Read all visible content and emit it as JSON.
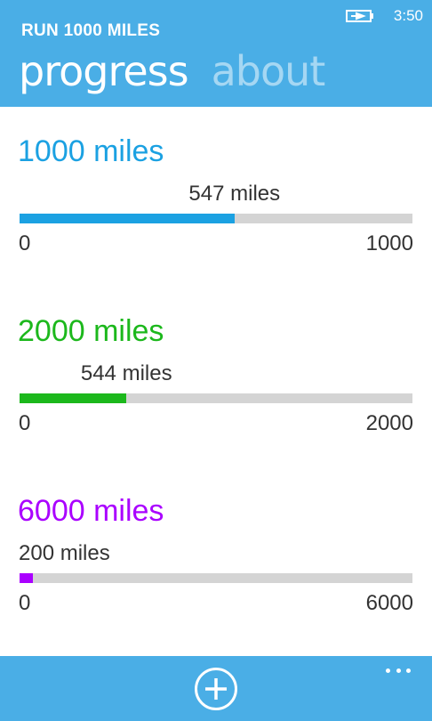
{
  "status": {
    "time": "3:50",
    "battery_icon": "battery-charging-icon"
  },
  "app": {
    "title": "RUN 1000 MILES"
  },
  "pivot": {
    "active": "progress",
    "inactive": "about"
  },
  "colors": {
    "accent": "#4aaee6",
    "track": "#d4d4d4"
  },
  "goals": [
    {
      "title": "1000 miles",
      "current_label": "547 miles",
      "min_label": "0",
      "max_label": "1000",
      "progress": 0.547,
      "color": "#1ba1e2"
    },
    {
      "title": "2000 miles",
      "current_label": "544 miles",
      "min_label": "0",
      "max_label": "2000",
      "progress": 0.272,
      "color": "#1cb81c"
    },
    {
      "title": "6000 miles",
      "current_label": "200 miles",
      "min_label": "0",
      "max_label": "6000",
      "progress": 0.0333,
      "color": "#aa00ff"
    }
  ],
  "app_bar": {
    "add_icon": "add-circle-icon",
    "more_icon": "ellipsis-icon"
  }
}
